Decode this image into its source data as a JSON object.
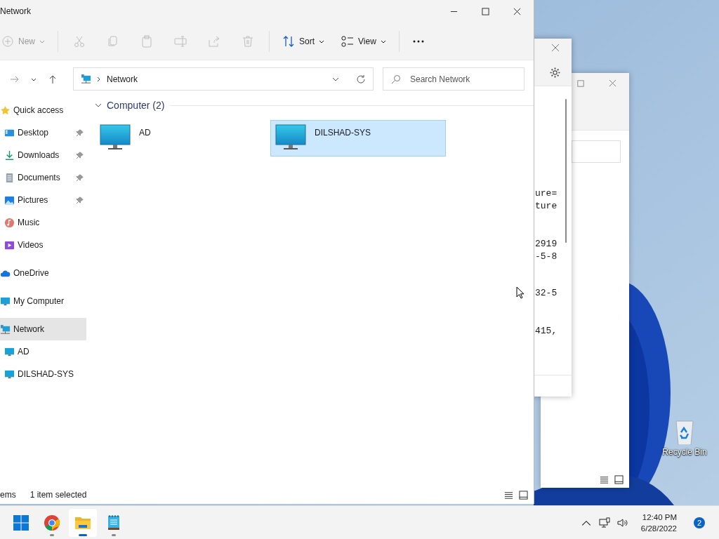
{
  "explorer": {
    "title": "Network",
    "toolbar": [
      {
        "kind": "new",
        "label": "New",
        "disabled": true
      },
      {
        "kind": "cut",
        "disabled": true
      },
      {
        "kind": "copy",
        "disabled": true
      },
      {
        "kind": "paste",
        "disabled": true
      },
      {
        "kind": "rename",
        "disabled": true
      },
      {
        "kind": "share",
        "disabled": true
      },
      {
        "kind": "delete",
        "disabled": true
      },
      {
        "kind": "sort",
        "label": "Sort",
        "disabled": false
      },
      {
        "kind": "view",
        "label": "View",
        "disabled": false
      },
      {
        "kind": "more",
        "disabled": false
      }
    ],
    "address": {
      "path": "Network"
    },
    "search": {
      "placeholder": "Search Network"
    },
    "sidebar": {
      "items": [
        {
          "label": "Quick access",
          "kind": "star",
          "selected": false,
          "children": [
            {
              "label": "Desktop",
              "kind": "desktop",
              "pinned": true,
              "selected": false
            },
            {
              "label": "Downloads",
              "kind": "download",
              "pinned": true,
              "selected": false
            },
            {
              "label": "Documents",
              "kind": "document",
              "pinned": true,
              "selected": false
            },
            {
              "label": "Pictures",
              "kind": "pictures",
              "pinned": true,
              "selected": false
            },
            {
              "label": "Music",
              "kind": "music",
              "pinned": false,
              "selected": false
            },
            {
              "label": "Videos",
              "kind": "videos",
              "pinned": false,
              "selected": false
            }
          ]
        },
        {
          "label": "OneDrive",
          "kind": "cloud",
          "selected": false
        },
        {
          "label": "My Computer",
          "kind": "monitor",
          "selected": false
        },
        {
          "label": "Network",
          "kind": "network",
          "selected": true,
          "children": [
            {
              "label": "AD",
              "kind": "monitor",
              "selected": false
            },
            {
              "label": "DILSHAD-SYS",
              "kind": "monitor",
              "selected": false
            }
          ]
        }
      ]
    },
    "group": {
      "label": "Computer (2)",
      "expanded": true,
      "items": [
        {
          "name": "AD",
          "selected": false
        },
        {
          "name": "DILSHAD-SYS",
          "selected": true
        }
      ]
    },
    "status_bar": {
      "item_count": "ems",
      "selection": "1 item selected"
    }
  },
  "back_window": {
    "code_blocks": [
      [
        "ure=",
        "ture"
      ],
      [
        "2919",
        "-5-8"
      ],
      [
        "32-5"
      ],
      [
        "415,"
      ]
    ]
  },
  "desktop_icons": [
    {
      "label": "Recycle Bin"
    }
  ],
  "taskbar": {
    "apps": [
      {
        "kind": "start",
        "running": false,
        "active": false
      },
      {
        "kind": "chrome",
        "running": true,
        "active": false
      },
      {
        "kind": "explorer",
        "running": true,
        "active": true
      },
      {
        "kind": "notepad",
        "running": true,
        "active": false
      }
    ],
    "time": "12:40 PM",
    "date": "6/28/2022",
    "notifications": "2"
  }
}
